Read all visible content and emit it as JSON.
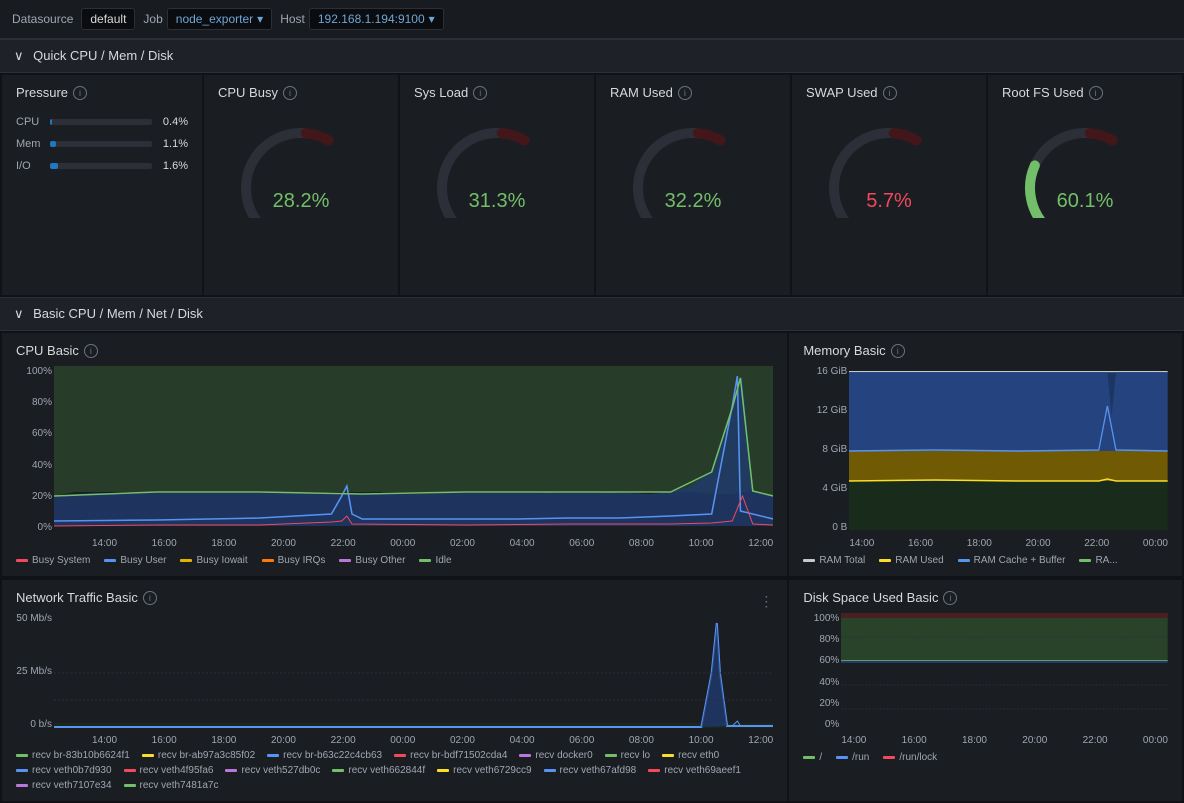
{
  "topbar": {
    "datasource_label": "Datasource",
    "datasource_value": "default",
    "job_label": "Job",
    "job_value": "node_exporter",
    "host_label": "Host",
    "host_value": "192.168.1.194:9100"
  },
  "section1": {
    "title": "Quick CPU / Mem / Disk"
  },
  "pressure": {
    "title": "Pressure",
    "bars": [
      {
        "label": "CPU",
        "value": "0.4%",
        "pct": 0.4
      },
      {
        "label": "Mem",
        "value": "1.1%",
        "pct": 1.1
      },
      {
        "label": "I/O",
        "value": "1.6%",
        "pct": 1.6
      }
    ]
  },
  "gauges": [
    {
      "title": "CPU Busy",
      "value": "28.2%",
      "color": "green",
      "pct": 28.2
    },
    {
      "title": "Sys Load",
      "value": "31.3%",
      "color": "green",
      "pct": 31.3
    },
    {
      "title": "RAM Used",
      "value": "32.2%",
      "color": "green",
      "pct": 32.2
    },
    {
      "title": "SWAP Used",
      "value": "5.7%",
      "color": "red",
      "pct": 5.7
    },
    {
      "title": "Root FS Used",
      "value": "60.1%",
      "color": "green",
      "pct": 60.1
    }
  ],
  "section2": {
    "title": "Basic CPU / Mem / Net / Disk"
  },
  "cpu_basic": {
    "title": "CPU Basic",
    "y_labels": [
      "100%",
      "80%",
      "60%",
      "40%",
      "20%",
      "0%"
    ],
    "x_labels": [
      "14:00",
      "16:00",
      "18:00",
      "20:00",
      "22:00",
      "00:00",
      "02:00",
      "04:00",
      "06:00",
      "08:00",
      "10:00",
      "12:00"
    ],
    "legend": [
      {
        "label": "Busy System",
        "color": "#f2495c"
      },
      {
        "label": "Busy User",
        "color": "#5794f2"
      },
      {
        "label": "Busy Iowait",
        "color": "#e0b400"
      },
      {
        "label": "Busy IRQs",
        "color": "#ff780a"
      },
      {
        "label": "Busy Other",
        "color": "#b877d9"
      },
      {
        "label": "Idle",
        "color": "#73bf69"
      }
    ]
  },
  "memory_basic": {
    "title": "Memory Basic",
    "y_labels": [
      "16 GiB",
      "12 GiB",
      "8 GiB",
      "4 GiB",
      "0 B"
    ],
    "x_labels": [
      "14:00",
      "16:00",
      "18:00",
      "20:00",
      "22:00",
      "00:00"
    ],
    "legend": [
      {
        "label": "RAM Total",
        "color": "#c8c8c8"
      },
      {
        "label": "RAM Used",
        "color": "#fade2a"
      },
      {
        "label": "RAM Cache + Buffer",
        "color": "#5794f2"
      },
      {
        "label": "RA...",
        "color": "#73bf69"
      }
    ]
  },
  "network_traffic": {
    "title": "Network Traffic Basic",
    "y_labels": [
      "50 Mb/s",
      "25 Mb/s",
      "0 b/s"
    ],
    "x_labels": [
      "14:00",
      "16:00",
      "18:00",
      "20:00",
      "22:00",
      "00:00",
      "02:00",
      "04:00",
      "06:00",
      "08:00",
      "10:00",
      "12:00"
    ],
    "legend": [
      {
        "label": "recv br-83b10b6624f1",
        "color": "#73bf69"
      },
      {
        "label": "recv br-ab97a3c85f02",
        "color": "#fade2a"
      },
      {
        "label": "recv br-b63c22c4cb63",
        "color": "#5794f2"
      },
      {
        "label": "recv br-bdf71502cda4",
        "color": "#f2495c"
      },
      {
        "label": "recv docker0",
        "color": "#b877d9"
      },
      {
        "label": "recv lo",
        "color": "#73bf69"
      },
      {
        "label": "recv eth0",
        "color": "#fade2a"
      },
      {
        "label": "recv veth0b7d930",
        "color": "#5794f2"
      },
      {
        "label": "recv veth4f95fa6",
        "color": "#f2495c"
      },
      {
        "label": "recv veth527db0c",
        "color": "#b877d9"
      },
      {
        "label": "recv veth662844f",
        "color": "#73bf69"
      },
      {
        "label": "recv veth6729cc9",
        "color": "#fade2a"
      },
      {
        "label": "recv veth67afd98",
        "color": "#5794f2"
      },
      {
        "label": "recv veth69aeef1",
        "color": "#f2495c"
      },
      {
        "label": "recv veth7107e34",
        "color": "#b877d9"
      },
      {
        "label": "recv veth7481a7c",
        "color": "#73bf69"
      }
    ]
  },
  "disk_space": {
    "title": "Disk Space Used Basic",
    "y_labels": [
      "100%",
      "80%",
      "60%",
      "40%",
      "20%",
      "0%"
    ],
    "x_labels": [
      "14:00",
      "16:00",
      "18:00",
      "20:00",
      "22:00",
      "00:00"
    ],
    "legend": [
      {
        "label": "/",
        "color": "#73bf69"
      },
      {
        "label": "/run",
        "color": "#5794f2"
      },
      {
        "label": "/run/lock",
        "color": "#f2495c"
      }
    ]
  }
}
